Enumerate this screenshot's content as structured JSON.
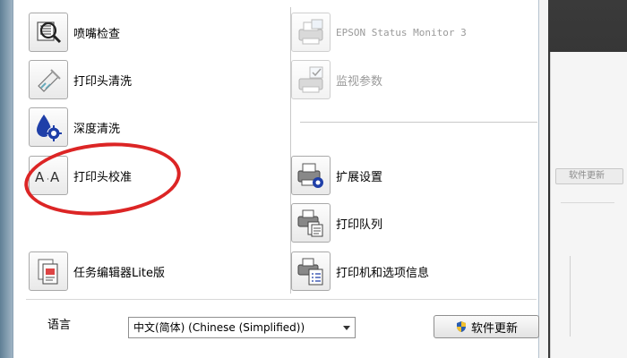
{
  "left_tools": [
    {
      "label": "喷嘴检查",
      "icon": "nozzle-check-icon"
    },
    {
      "label": "打印头清洗",
      "icon": "head-cleaning-icon"
    },
    {
      "label": "深度清洗",
      "icon": "power-cleaning-icon"
    },
    {
      "label": "打印头校准",
      "icon": "head-alignment-icon"
    },
    {
      "label": "任务编辑器Lite版",
      "icon": "job-arranger-icon"
    }
  ],
  "right_tools": [
    {
      "label": "EPSON Status Monitor 3",
      "icon": "status-monitor-icon",
      "disabled": true
    },
    {
      "label": "监视参数",
      "icon": "monitoring-preferences-icon",
      "disabled": true
    },
    {
      "label": "扩展设置",
      "icon": "extended-settings-icon"
    },
    {
      "label": "打印队列",
      "icon": "print-queue-icon"
    },
    {
      "label": "打印机和选项信息",
      "icon": "printer-info-icon"
    }
  ],
  "language": {
    "label": "语言",
    "selected": "中文(简体) (Chinese (Simplified))"
  },
  "update_button": {
    "label": "软件更新",
    "icon": "shield-icon"
  },
  "background_window": {
    "button_label": "软件更新"
  },
  "colors": {
    "highlight_circle": "#dc2525",
    "cleaning_blue": "#1f3fa8"
  }
}
